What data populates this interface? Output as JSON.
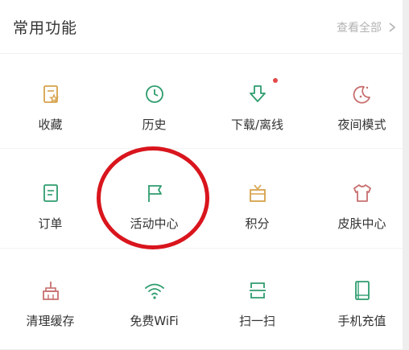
{
  "header": {
    "title": "常用功能",
    "view_all": "查看全部"
  },
  "colors": {
    "icon_green": "#2e9c6e",
    "icon_red": "#c86e6e",
    "icon_yellow": "#d6a24a",
    "badge_red": "#e14b4b",
    "annotation_red": "#d9151d"
  },
  "grid": [
    [
      {
        "label": "收藏",
        "icon": "favorites-icon"
      },
      {
        "label": "历史",
        "icon": "history-clock-icon"
      },
      {
        "label": "下载/离线",
        "icon": "download-arrow-icon",
        "badge": true
      },
      {
        "label": "夜间模式",
        "icon": "night-mode-moon-icon"
      }
    ],
    [
      {
        "label": "订单",
        "icon": "order-document-icon"
      },
      {
        "label": "活动中心",
        "icon": "flag-icon"
      },
      {
        "label": "积分",
        "icon": "gift-box-icon"
      },
      {
        "label": "皮肤中心",
        "icon": "t-shirt-icon"
      }
    ],
    [
      {
        "label": "清理缓存",
        "icon": "broom-clean-icon"
      },
      {
        "label": "免费WiFi",
        "icon": "wifi-icon"
      },
      {
        "label": "扫一扫",
        "icon": "scan-icon"
      },
      {
        "label": "手机充值",
        "icon": "phone-recharge-book-icon"
      }
    ]
  ]
}
